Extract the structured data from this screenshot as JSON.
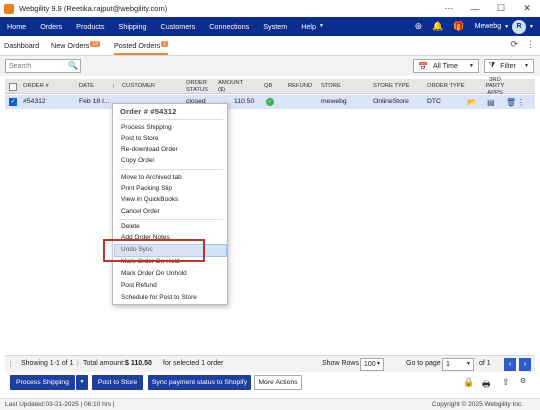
{
  "window": {
    "title": "Webgility 9.9 (Reetika.rajput@webgility.com)",
    "controls": [
      "⋯",
      "—",
      "☐",
      "✕"
    ]
  },
  "nav": {
    "items": [
      "Home",
      "Orders",
      "Products",
      "Shipping",
      "Customers",
      "Connections",
      "System",
      "Help"
    ],
    "user": "Mewebg",
    "avatar_initial": "R"
  },
  "tabs": [
    {
      "label": "Dashboard"
    },
    {
      "label": "New Orders",
      "badge": "13"
    },
    {
      "label": "Posted Orders",
      "badge": "1"
    }
  ],
  "filters": {
    "search_placeholder": "Search",
    "time_range": "All Time",
    "filter_label": "Filter"
  },
  "table": {
    "headers": [
      "ORDER #",
      "DATE",
      "CUSTOMER",
      "ORDER STATUS",
      "AMOUNT ($)",
      "QB",
      "REFUND",
      "STORE",
      "STORE TYPE",
      "ORDER TYPE",
      "3RD PARTY APPS"
    ],
    "rows": [
      {
        "order": "#54312",
        "date": "Feb 18",
        "customer": "I...",
        "status": "closed",
        "amount": "110.50",
        "qb": "✓",
        "refund": "",
        "store": "mewebg",
        "store_type": "OnlineStore",
        "order_type": "DTC"
      }
    ]
  },
  "context_menu": {
    "title": "Order # #54312",
    "groups": [
      [
        "Process Shipping",
        "Post to Store",
        "Re-download Order",
        "Copy Order"
      ],
      [
        "Move to Archived tab",
        "Print Packing Slip",
        "View in QuickBooks",
        "Cancel Order"
      ],
      [
        "Delete",
        "Add Order Notes",
        "Undo Sync",
        "Mark Order On Hold",
        "Mark Order On Unhold",
        "Post Refund",
        "Schedule for Post to Store"
      ]
    ],
    "highlighted": "Undo Sync"
  },
  "status": {
    "showing": "Showing 1-1 of 1",
    "total_prefix": "Total amount:",
    "total_amount": "$ 110.50",
    "total_suffix": "for selected 1 order",
    "show_rows_label": "Show Rows",
    "show_rows": "100",
    "go_to_page_label": "Go to page",
    "page": "1",
    "of_pages": "of 1"
  },
  "actions": {
    "process_shipping": "Process Shipping",
    "post_to_store": "Post to Store",
    "sync_payment": "Sync payment status to Shopify",
    "more_actions": "More Actions"
  },
  "footer": {
    "last_updated": "Last Updated:03-21-2025 | 06:10 hrs |",
    "copyright": "Copyright © 2025 Webgility Inc."
  },
  "colors": {
    "nav": "#0b2d8f",
    "accent": "#f2873b",
    "highlight_box": "#b23a2a"
  }
}
